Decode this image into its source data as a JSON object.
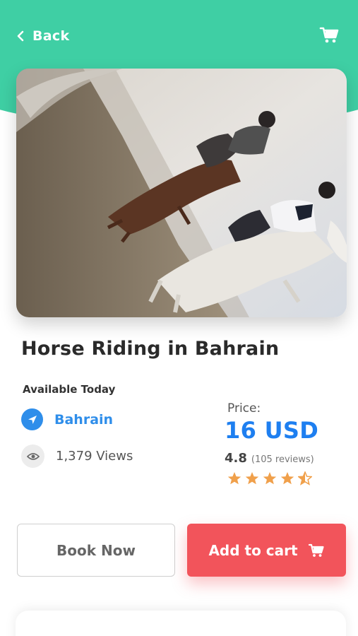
{
  "header": {
    "back_label": "Back",
    "back_icon": "chevron-left-icon",
    "cart_icon": "cart-icon"
  },
  "activity": {
    "title": "Horse Riding in Bahrain",
    "availability": "Available Today",
    "location": "Bahrain",
    "views": "1,379 Views",
    "price_label": "Price:",
    "price": "16 USD",
    "rating": "4.8",
    "reviews": "(105 reviews)",
    "stars": 4.5
  },
  "actions": {
    "book_label": "Book Now",
    "add_to_cart_label": "Add to cart"
  },
  "colors": {
    "header": "#3fcfa4",
    "accent_blue": "#1e7ff0",
    "cart_button": "#f2545b",
    "star": "#f0a04b"
  }
}
